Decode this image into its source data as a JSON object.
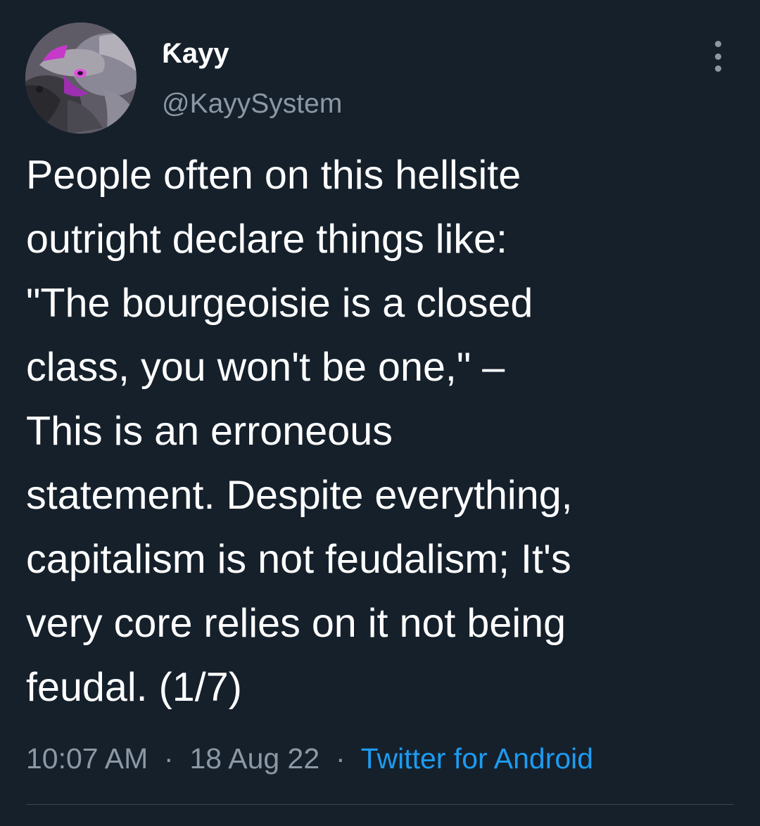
{
  "author": {
    "display_name": "Ƙayy",
    "handle": "@KayySystem"
  },
  "tweet": {
    "lines": [
      "People often on this hellsite",
      "outright declare things like:",
      "\"The bourgeoisie is a closed",
      "class, you won't be one,\" –",
      "This is an erroneous",
      "statement. Despite everything,",
      "capitalism is not feudalism; It's",
      "very core relies on it not being",
      "feudal. (1/7)"
    ],
    "time": "10:07 AM",
    "date": "18 Aug 22",
    "separator": "·",
    "source": "Twitter for Android"
  },
  "icons": {
    "more": "more-vertical-icon"
  },
  "colors": {
    "background": "#15202b",
    "text": "#ffffff",
    "secondary": "#8b98a5",
    "link": "#1d9bf0",
    "divider": "#38444d"
  }
}
